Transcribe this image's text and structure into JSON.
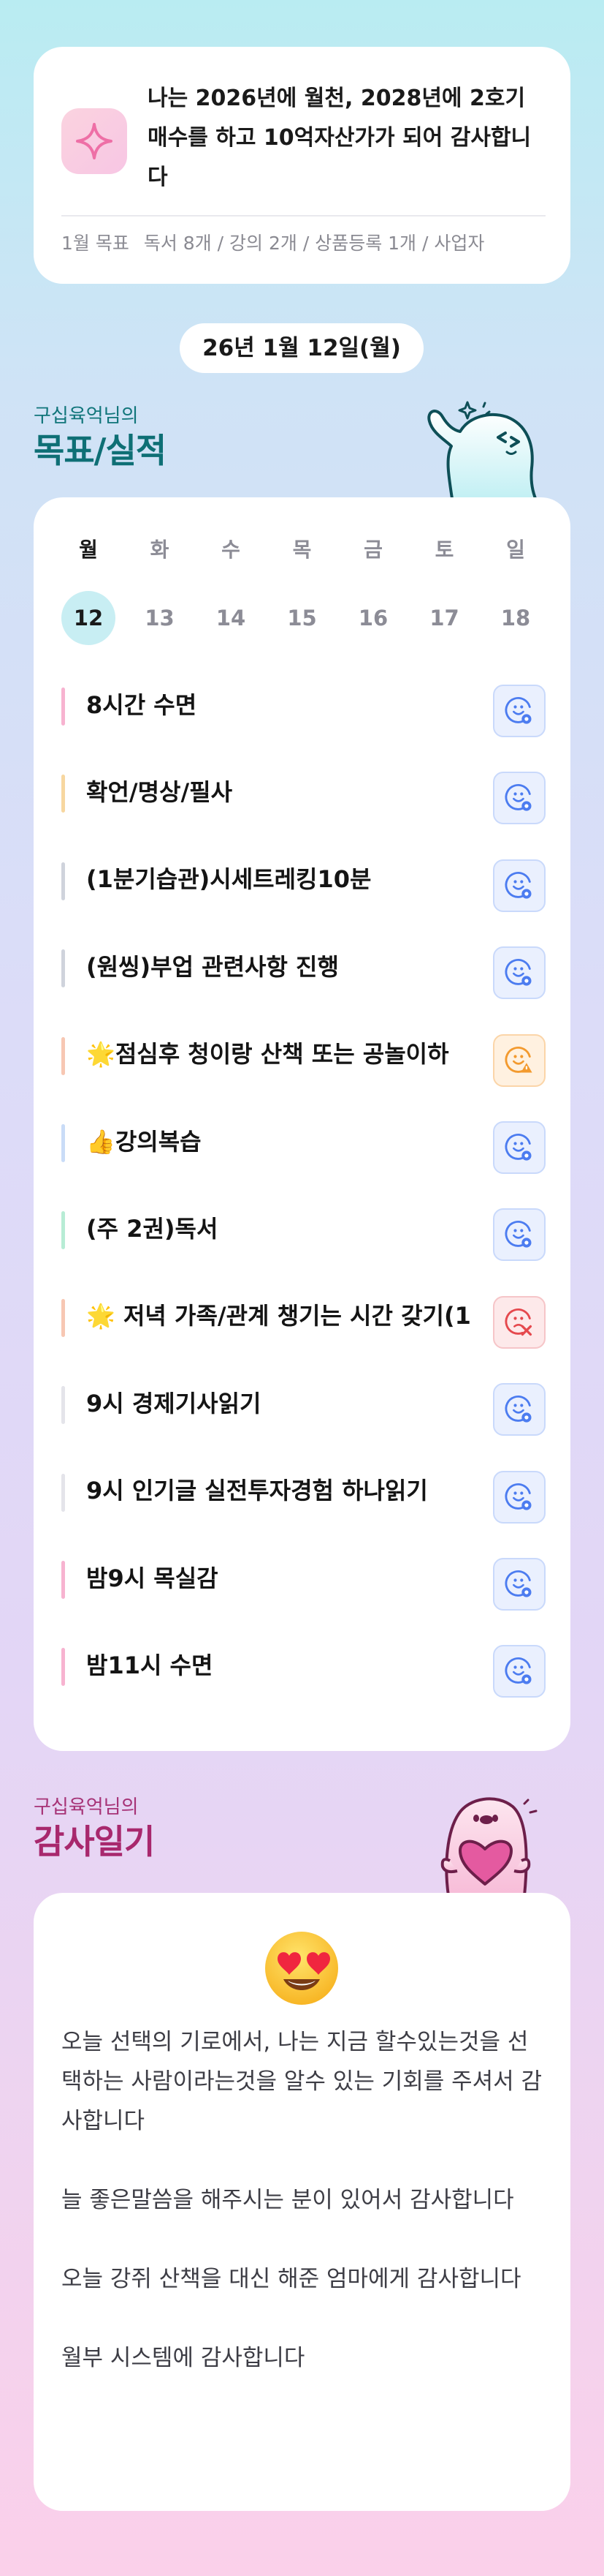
{
  "goal": {
    "icon": "sparkle-icon",
    "text": "나는 2026년에 월천, 2028년에 2호기 매수를 하고 10억자산가가 되어 감사합니다",
    "month_label": "1월 목표",
    "summary": "독서 8개 / 강의 2개 / 상품등록 1개 / 사업자",
    "accent": "#f08bb4"
  },
  "date": "26년 1월 12일(월)",
  "plan_section": {
    "subtitle": "구십육억님의",
    "title": "목표/실적"
  },
  "week": {
    "days": [
      "월",
      "화",
      "수",
      "목",
      "금",
      "토",
      "일"
    ],
    "dates": [
      "12",
      "13",
      "14",
      "15",
      "16",
      "17",
      "18"
    ],
    "active_index": 0
  },
  "tasks": [
    {
      "label": "8시간 수면",
      "color": "#f7b3d0",
      "status": "done"
    },
    {
      "label": "확언/명상/필사",
      "color": "#f7d7a0",
      "status": "done"
    },
    {
      "label": "(1분기습관)시세트레킹10분",
      "color": "#cfd3dc",
      "status": "done"
    },
    {
      "label": "(원씽)부업 관련사항 진행",
      "color": "#cfd3dc",
      "status": "done"
    },
    {
      "label": "🌟점심후 청이랑 산책 또는 공놀이하",
      "color": "#f7c7b3",
      "status": "partial"
    },
    {
      "label": "👍강의복습",
      "color": "#c9dcf7",
      "status": "done"
    },
    {
      "label": "(주 2권)독서",
      "color": "#b7ecd5",
      "status": "done"
    },
    {
      "label": "🌟 저녁 가족/관계 챙기는 시간 갖기(1",
      "color": "#f7c7b3",
      "status": "missed"
    },
    {
      "label": "9시 경제기사읽기",
      "color": "#e4e4ea",
      "status": "done"
    },
    {
      "label": "9시 인기글 실전투자경험 하나읽기",
      "color": "#e4e4ea",
      "status": "done"
    },
    {
      "label": "밤9시 목실감",
      "color": "#f7b3d0",
      "status": "done"
    },
    {
      "label": "밤11시 수면",
      "color": "#f7b3d0",
      "status": "done"
    }
  ],
  "thanks_section": {
    "subtitle": "구십육억님의",
    "title": "감사일기",
    "emoji": "heart-eyes-emoji",
    "entries": [
      "오늘 선택의 기로에서, 나는 지금 할수있는것을 선택하는 사람이라는것을 알수 있는 기회를 주셔서 감사합니다",
      "늘 좋은말씀을 해주시는 분이 있어서 감사합니다",
      "오늘 강쥐 산책을 대신 해준 엄마에게 감사합니다",
      "월부 시스템에 감사합니다"
    ]
  },
  "colors": {
    "teal_title": "#0e6f75",
    "pink_title": "#a8286d",
    "status_blue": "#4c7cf0",
    "status_orange": "#f39a2e",
    "status_red": "#e5484d"
  }
}
